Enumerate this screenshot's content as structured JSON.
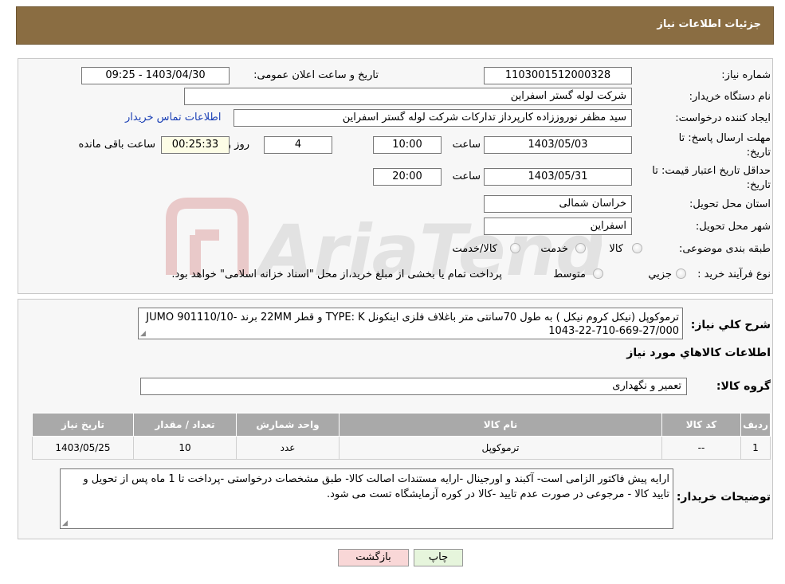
{
  "header": {
    "title": "جزئیات اطلاعات نیاز"
  },
  "form": {
    "need_number_label": "شماره نیاز:",
    "need_number": "1103001512000328",
    "announce_label": "تاریخ و ساعت اعلان عمومی:",
    "announce_value": "1403/04/30 - 09:25",
    "buyer_org_label": "نام دستگاه خریدار:",
    "buyer_org": "شرکت لوله گستر اسفراین",
    "creator_label": "ایجاد کننده درخواست:",
    "creator": "سید مظفر نوروززاده کارپرداز تدارکات شرکت لوله گستر اسفراین",
    "contact_link": "اطلاعات تماس خریدار",
    "deadline_label_1": "مهلت ارسال پاسخ: تا",
    "deadline_label_2": "تاریخ:",
    "deadline_date": "1403/05/03",
    "time_label": "ساعت",
    "deadline_time": "10:00",
    "days_value": "4",
    "days_label": "روز و",
    "remaining_value": "00:25:33",
    "remaining_label": "ساعت باقی مانده",
    "validity_label_1": "حداقل تاریخ اعتبار قیمت: تا",
    "validity_label_2": "تاریخ:",
    "validity_date": "1403/05/31",
    "validity_time": "20:00",
    "province_label": "استان محل تحویل:",
    "province": "خراسان شمالی",
    "city_label": "شهر محل تحویل:",
    "city": "اسفراین",
    "category_label": "طبقه بندی موضوعی:",
    "category_options": [
      "کالا",
      "خدمت",
      "کالا/خدمت"
    ],
    "purchase_type_label": "نوع فرآیند خرید :",
    "purchase_options": [
      "جزیي",
      "متوسط"
    ],
    "purchase_note": "پرداخت تمام یا بخشی از مبلغ خرید،از محل \"اسناد خزانه اسلامی\" خواهد بود."
  },
  "description": {
    "label": "شرح کلي نیاز:",
    "text": "ترموکوپل (نیکل کروم نیکل ) به طول 70سانتی متر باغلاف فلزی اینکونل TYPE: K و قطر 22MM برند JUMO 901110/10-1043-22-710-669-27/000"
  },
  "goods": {
    "section_title": "اطلاعات کالاهاي مورد نیاز",
    "group_label": "گروه کالا:",
    "group_value": "تعمیر و نگهداری",
    "columns": [
      "ردیف",
      "کد کالا",
      "نام کالا",
      "واحد شمارش",
      "تعداد / مقدار",
      "تاریخ نیاز"
    ],
    "rows": [
      [
        "1",
        "--",
        "ترموکوپل",
        "عدد",
        "10",
        "1403/05/25"
      ]
    ]
  },
  "buyer_notes": {
    "label": "توضیحات خریدار:",
    "text": "ارایه پیش فاکتور الزامی است- آکبند و اورجینال -ارایه مستندات اصالت کالا- طبق مشخصات درخواستی -پرداخت تا 1 ماه پس از تحویل و تایید کالا - مرجوعی در صورت عدم تایید -کالا در کوره آزمایشگاه تست می شود."
  },
  "buttons": {
    "print": "چاپ",
    "back": "بازگشت"
  },
  "colors": {
    "header": "#8a6d42",
    "table_header": "#a9a9a9",
    "back_button": "#f9d7d7",
    "print_button": "#e6f5dc"
  }
}
